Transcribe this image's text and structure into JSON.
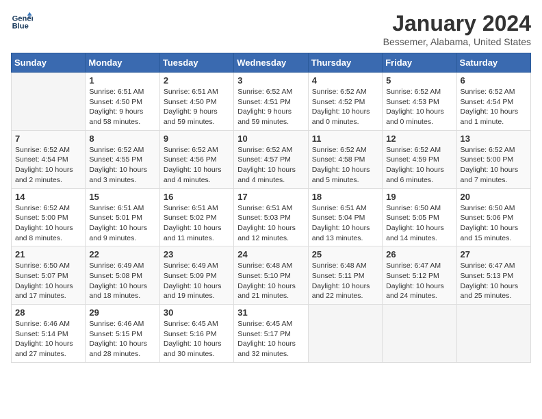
{
  "header": {
    "logo_line1": "General",
    "logo_line2": "Blue",
    "month": "January 2024",
    "location": "Bessemer, Alabama, United States"
  },
  "weekdays": [
    "Sunday",
    "Monday",
    "Tuesday",
    "Wednesday",
    "Thursday",
    "Friday",
    "Saturday"
  ],
  "weeks": [
    [
      {
        "day": "",
        "info": ""
      },
      {
        "day": "1",
        "info": "Sunrise: 6:51 AM\nSunset: 4:50 PM\nDaylight: 9 hours\nand 58 minutes."
      },
      {
        "day": "2",
        "info": "Sunrise: 6:51 AM\nSunset: 4:50 PM\nDaylight: 9 hours\nand 59 minutes."
      },
      {
        "day": "3",
        "info": "Sunrise: 6:52 AM\nSunset: 4:51 PM\nDaylight: 9 hours\nand 59 minutes."
      },
      {
        "day": "4",
        "info": "Sunrise: 6:52 AM\nSunset: 4:52 PM\nDaylight: 10 hours\nand 0 minutes."
      },
      {
        "day": "5",
        "info": "Sunrise: 6:52 AM\nSunset: 4:53 PM\nDaylight: 10 hours\nand 0 minutes."
      },
      {
        "day": "6",
        "info": "Sunrise: 6:52 AM\nSunset: 4:54 PM\nDaylight: 10 hours\nand 1 minute."
      }
    ],
    [
      {
        "day": "7",
        "info": "Sunrise: 6:52 AM\nSunset: 4:54 PM\nDaylight: 10 hours\nand 2 minutes."
      },
      {
        "day": "8",
        "info": "Sunrise: 6:52 AM\nSunset: 4:55 PM\nDaylight: 10 hours\nand 3 minutes."
      },
      {
        "day": "9",
        "info": "Sunrise: 6:52 AM\nSunset: 4:56 PM\nDaylight: 10 hours\nand 4 minutes."
      },
      {
        "day": "10",
        "info": "Sunrise: 6:52 AM\nSunset: 4:57 PM\nDaylight: 10 hours\nand 4 minutes."
      },
      {
        "day": "11",
        "info": "Sunrise: 6:52 AM\nSunset: 4:58 PM\nDaylight: 10 hours\nand 5 minutes."
      },
      {
        "day": "12",
        "info": "Sunrise: 6:52 AM\nSunset: 4:59 PM\nDaylight: 10 hours\nand 6 minutes."
      },
      {
        "day": "13",
        "info": "Sunrise: 6:52 AM\nSunset: 5:00 PM\nDaylight: 10 hours\nand 7 minutes."
      }
    ],
    [
      {
        "day": "14",
        "info": "Sunrise: 6:52 AM\nSunset: 5:00 PM\nDaylight: 10 hours\nand 8 minutes."
      },
      {
        "day": "15",
        "info": "Sunrise: 6:51 AM\nSunset: 5:01 PM\nDaylight: 10 hours\nand 9 minutes."
      },
      {
        "day": "16",
        "info": "Sunrise: 6:51 AM\nSunset: 5:02 PM\nDaylight: 10 hours\nand 11 minutes."
      },
      {
        "day": "17",
        "info": "Sunrise: 6:51 AM\nSunset: 5:03 PM\nDaylight: 10 hours\nand 12 minutes."
      },
      {
        "day": "18",
        "info": "Sunrise: 6:51 AM\nSunset: 5:04 PM\nDaylight: 10 hours\nand 13 minutes."
      },
      {
        "day": "19",
        "info": "Sunrise: 6:50 AM\nSunset: 5:05 PM\nDaylight: 10 hours\nand 14 minutes."
      },
      {
        "day": "20",
        "info": "Sunrise: 6:50 AM\nSunset: 5:06 PM\nDaylight: 10 hours\nand 15 minutes."
      }
    ],
    [
      {
        "day": "21",
        "info": "Sunrise: 6:50 AM\nSunset: 5:07 PM\nDaylight: 10 hours\nand 17 minutes."
      },
      {
        "day": "22",
        "info": "Sunrise: 6:49 AM\nSunset: 5:08 PM\nDaylight: 10 hours\nand 18 minutes."
      },
      {
        "day": "23",
        "info": "Sunrise: 6:49 AM\nSunset: 5:09 PM\nDaylight: 10 hours\nand 19 minutes."
      },
      {
        "day": "24",
        "info": "Sunrise: 6:48 AM\nSunset: 5:10 PM\nDaylight: 10 hours\nand 21 minutes."
      },
      {
        "day": "25",
        "info": "Sunrise: 6:48 AM\nSunset: 5:11 PM\nDaylight: 10 hours\nand 22 minutes."
      },
      {
        "day": "26",
        "info": "Sunrise: 6:47 AM\nSunset: 5:12 PM\nDaylight: 10 hours\nand 24 minutes."
      },
      {
        "day": "27",
        "info": "Sunrise: 6:47 AM\nSunset: 5:13 PM\nDaylight: 10 hours\nand 25 minutes."
      }
    ],
    [
      {
        "day": "28",
        "info": "Sunrise: 6:46 AM\nSunset: 5:14 PM\nDaylight: 10 hours\nand 27 minutes."
      },
      {
        "day": "29",
        "info": "Sunrise: 6:46 AM\nSunset: 5:15 PM\nDaylight: 10 hours\nand 28 minutes."
      },
      {
        "day": "30",
        "info": "Sunrise: 6:45 AM\nSunset: 5:16 PM\nDaylight: 10 hours\nand 30 minutes."
      },
      {
        "day": "31",
        "info": "Sunrise: 6:45 AM\nSunset: 5:17 PM\nDaylight: 10 hours\nand 32 minutes."
      },
      {
        "day": "",
        "info": ""
      },
      {
        "day": "",
        "info": ""
      },
      {
        "day": "",
        "info": ""
      }
    ]
  ]
}
